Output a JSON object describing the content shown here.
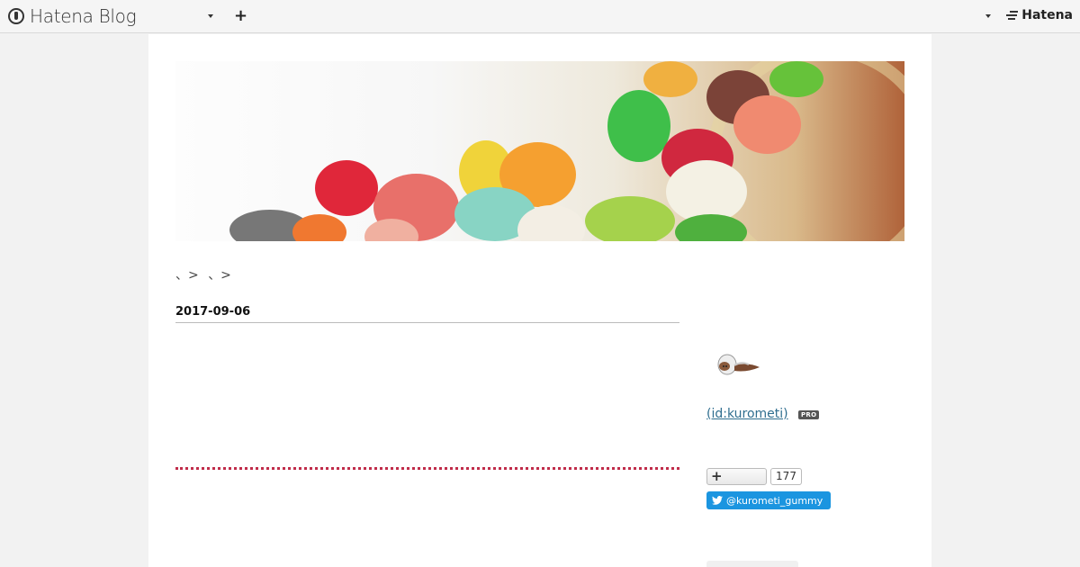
{
  "header": {
    "logo_text": "Hatena Blog",
    "logo_icon": "hatena-blog-logo-icon",
    "add_icon": "plus-icon",
    "right_brand": "Hatena"
  },
  "breadcrumb": {
    "items": [
      "、>",
      "、>"
    ]
  },
  "article": {
    "date": "2017-09-06"
  },
  "sidebar": {
    "profile_link": " (id:kurometi)",
    "pro_badge": "PRO",
    "follow_count": "177",
    "twitter_label": "@kurometi_gummy"
  },
  "colors": {
    "accent_dots": "#c02c4a",
    "link": "#2f6e8f",
    "twitter": "#1b95e0"
  }
}
